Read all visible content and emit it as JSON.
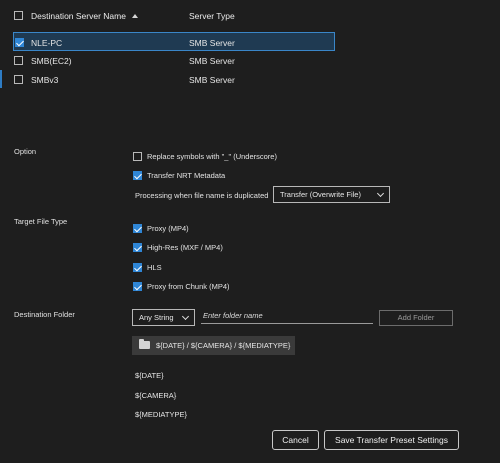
{
  "table": {
    "header": {
      "name": "Destination Server Name",
      "type": "Server Type"
    },
    "rows": [
      {
        "name": "NLE-PC",
        "type": "SMB Server",
        "checked": true
      },
      {
        "name": "SMB(EC2)",
        "type": "SMB Server",
        "checked": false
      },
      {
        "name": "SMBv3",
        "type": "SMB Server",
        "checked": false
      }
    ]
  },
  "option": {
    "label": "Option",
    "replace_symbols": "Replace symbols with \"_\" (Underscore)",
    "transfer_nrt": "Transfer NRT Metadata",
    "duplicate_label": "Processing when file name is duplicated",
    "duplicate_value": "Transfer (Overwrite File)"
  },
  "target": {
    "label": "Target File Type",
    "proxy": "Proxy (MP4)",
    "highres": "High-Res (MXF / MP4)",
    "hls": "HLS",
    "proxy_chunk": "Proxy from Chunk (MP4)"
  },
  "destination": {
    "label": "Destination Folder",
    "select_value": "Any String",
    "input_placeholder": "Enter folder name",
    "add_folder": "Add Folder",
    "path": "${DATE} / ${CAMERA} / ${MEDIATYPE}",
    "tokens": [
      "${DATE}",
      "${CAMERA}",
      "${MEDIATYPE}"
    ]
  },
  "footer": {
    "cancel": "Cancel",
    "save": "Save Transfer Preset Settings"
  },
  "colors": {
    "accent": "#2f86d6",
    "background": "#1e1e1e",
    "selected_row": "#1f3a52"
  }
}
